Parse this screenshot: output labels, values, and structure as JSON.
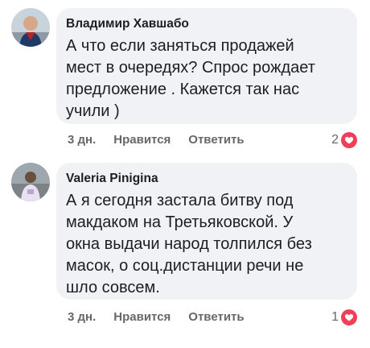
{
  "comments": [
    {
      "author": "Владимир Хавшабо",
      "text": "А что если заняться продажей\nмест в очередях? Спрос рождает\nпредложение . Кажется так нас\nучили )",
      "time": "3 дн.",
      "like_label": "Нравится",
      "reply_label": "Ответить",
      "reaction_count": "2"
    },
    {
      "author": "Valeria Pinigina",
      "text": "А я сегодня застала битву под\nмакдаком на Третьяковской. У\nокна выдачи народ толпился без\nмасок, о соц.дистанции речи не\nшло совсем.",
      "time": "3 дн.",
      "like_label": "Нравится",
      "reply_label": "Ответить",
      "reaction_count": "1"
    }
  ],
  "colors": {
    "bubble": "#f0f2f5",
    "secondary_text": "#65676b",
    "reaction_love": "#f33e58"
  },
  "icons": {
    "reaction": "love-reaction-icon"
  }
}
